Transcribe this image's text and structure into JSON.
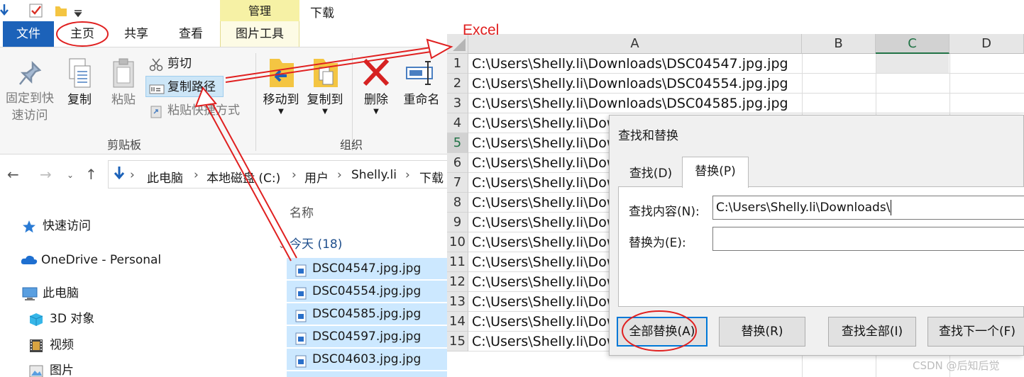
{
  "explorer": {
    "context_tab_group": "管理",
    "window_title": "下载",
    "tabs": [
      "文件",
      "主页",
      "共享",
      "查看",
      "图片工具"
    ],
    "ribbon": {
      "pin_label_1": "固定到快",
      "pin_label_2": "速访问",
      "copy_label": "复制",
      "paste_label": "粘贴",
      "cut_label": "剪切",
      "copy_path_label": "复制路径",
      "paste_shortcut_label": "粘贴快捷方式",
      "move_to_label": "移动到",
      "copy_to_label": "复制到",
      "delete_label": "删除",
      "rename_label": "重命名",
      "group_clipboard": "剪贴板",
      "group_organize": "组织"
    },
    "breadcrumb": [
      "此电脑",
      "本地磁盘 (C:)",
      "用户",
      "Shelly.li",
      "下载"
    ],
    "nav_pane": {
      "quick_access": "快速访问",
      "onedrive": "OneDrive - Personal",
      "this_pc": "此电脑",
      "objects_3d": "3D 对象",
      "videos": "视频",
      "pictures": "图片"
    },
    "column_name": "名称",
    "group_today": "今天 (18)",
    "files": [
      "DSC04547.jpg.jpg",
      "DSC04554.jpg.jpg",
      "DSC04585.jpg.jpg",
      "DSC04597.jpg.jpg",
      "DSC04603.jpg.jpg"
    ]
  },
  "excel": {
    "annotation_label": "Excel",
    "columns": [
      "A",
      "B",
      "C",
      "D"
    ],
    "selected_column": "C",
    "selected_row": "5",
    "rows": [
      {
        "num": "1",
        "a": "C:\\Users\\Shelly.li\\Downloads\\DSC04547.jpg.jpg"
      },
      {
        "num": "2",
        "a": "C:\\Users\\Shelly.li\\Downloads\\DSC04554.jpg.jpg"
      },
      {
        "num": "3",
        "a": "C:\\Users\\Shelly.li\\Downloads\\DSC04585.jpg.jpg"
      },
      {
        "num": "4",
        "a": "C:\\Users\\Shelly.li\\Dow"
      },
      {
        "num": "5",
        "a": "C:\\Users\\Shelly.li\\Dow"
      },
      {
        "num": "6",
        "a": "C:\\Users\\Shelly.li\\Dow"
      },
      {
        "num": "7",
        "a": "C:\\Users\\Shelly.li\\Dow"
      },
      {
        "num": "8",
        "a": "C:\\Users\\Shelly.li\\Dow"
      },
      {
        "num": "9",
        "a": "C:\\Users\\Shelly.li\\Dow"
      },
      {
        "num": "10",
        "a": "C:\\Users\\Shelly.li\\Dow"
      },
      {
        "num": "11",
        "a": "C:\\Users\\Shelly.li\\Dow"
      },
      {
        "num": "12",
        "a": "C:\\Users\\Shelly.li\\Dow"
      },
      {
        "num": "13",
        "a": "C:\\Users\\Shelly.li\\Dow"
      },
      {
        "num": "14",
        "a": "C:\\Users\\Shelly.li\\Dow"
      },
      {
        "num": "15",
        "a": "C:\\Users\\Shelly.li\\Dow"
      }
    ]
  },
  "dialog": {
    "title": "查找和替换",
    "tab_find": "查找(D)",
    "tab_replace": "替换(P)",
    "find_label": "查找内容(N):",
    "find_value": "C:\\Users\\Shelly.li\\Downloads\\",
    "replace_label": "替换为(E):",
    "replace_value": "",
    "btn_replace_all": "全部替换(A)",
    "btn_replace": "替换(R)",
    "btn_find_all": "查找全部(I)",
    "btn_find_next": "查找下一个(F)"
  },
  "watermark": "CSDN @后知后觉",
  "colors": {
    "annotation_red": "#e02020",
    "file_tab_blue": "#1c62b9",
    "selection_blue": "#cce8ff",
    "excel_green": "#217346",
    "context_tab_yellow": "#f6f1a5"
  }
}
